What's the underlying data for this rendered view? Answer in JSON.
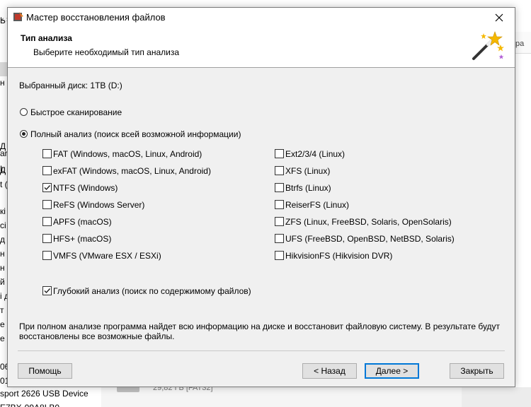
{
  "background": {
    "nav_arrows": "‹ ›",
    "left_fragments": [
      {
        "text": "Ь"
      },
      {
        "text": "н"
      },
      {
        "text": "Д"
      },
      {
        "text": "Д"
      },
      {
        "text": "ar"
      },
      {
        "text": "L ("
      },
      {
        "text": "t ("
      },
      {
        "text": "кі"
      },
      {
        "text": "ci"
      },
      {
        "text": "д"
      },
      {
        "text": "н"
      },
      {
        "text": "н"
      },
      {
        "text": "й д"
      },
      {
        "text": "i д"
      },
      {
        "text": "т"
      },
      {
        "text": "е"
      },
      {
        "text": "e"
      },
      {
        "text": "06"
      },
      {
        "text": "01-"
      },
      {
        "text": "sport 2626 USB Device"
      },
      {
        "text": "E7BX-09A8LB0"
      }
    ],
    "disk_text": "29,82 ГБ [FAT32]",
    "right_text": "ра"
  },
  "dialog": {
    "title": "Мастер восстановления файлов",
    "header_title": "Тип анализа",
    "header_subtitle": "Выберите необходимый тип анализа",
    "selected_disk": "Выбранный диск:  1TB (D:)",
    "radio_quick": "Быстрое сканирование",
    "radio_full": "Полный анализ (поиск всей возможной информации)",
    "selected_mode": "full",
    "fs_left": [
      {
        "label": "FAT (Windows, macOS, Linux, Android)",
        "checked": false
      },
      {
        "label": "exFAT (Windows, macOS, Linux, Android)",
        "checked": false
      },
      {
        "label": "NTFS (Windows)",
        "checked": true
      },
      {
        "label": "ReFS (Windows Server)",
        "checked": false
      },
      {
        "label": "APFS (macOS)",
        "checked": false
      },
      {
        "label": "HFS+ (macOS)",
        "checked": false
      },
      {
        "label": "VMFS (VMware ESX / ESXi)",
        "checked": false
      }
    ],
    "fs_right": [
      {
        "label": "Ext2/3/4 (Linux)",
        "checked": false
      },
      {
        "label": "XFS (Linux)",
        "checked": false
      },
      {
        "label": "Btrfs (Linux)",
        "checked": false
      },
      {
        "label": "ReiserFS (Linux)",
        "checked": false
      },
      {
        "label": "ZFS (Linux, FreeBSD, Solaris, OpenSolaris)",
        "checked": false
      },
      {
        "label": "UFS (FreeBSD, OpenBSD, NetBSD, Solaris)",
        "checked": false
      },
      {
        "label": "HikvisionFS (Hikvision DVR)",
        "checked": false
      }
    ],
    "deep_analysis": {
      "label": "Глубокий анализ (поиск по содержимому файлов)",
      "checked": true
    },
    "info_line1": "При полном анализе программа найдет всю информацию на диске и восстановит файловую систему. В результате будут",
    "info_line2": "восстановлены все возможные файлы.",
    "buttons": {
      "help": "Помощь",
      "back": "< Назад",
      "next": "Далее >",
      "close": "Закрыть"
    }
  },
  "colors": {
    "dialog_bg": "#f0f0f0",
    "header_bg": "#ffffff",
    "accent": "#0078d7"
  },
  "icons": [
    "app-icon",
    "close-icon",
    "magic-wand-icon",
    "checkmark-icon"
  ]
}
